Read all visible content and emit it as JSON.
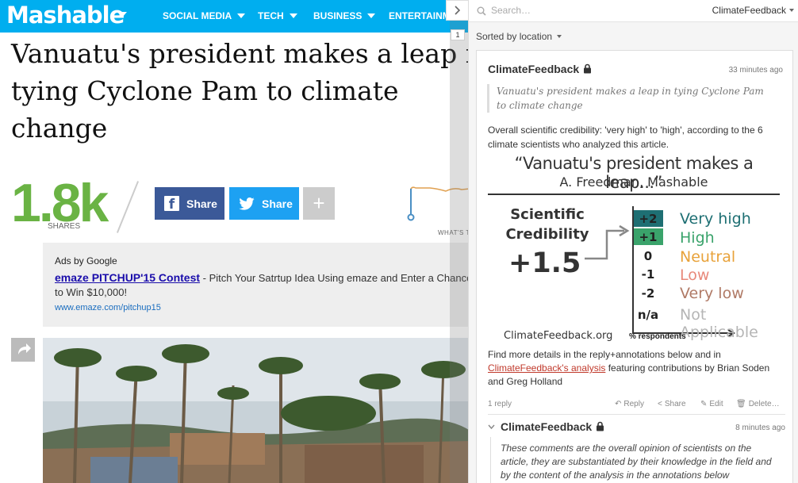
{
  "site": {
    "logo": "Mashable",
    "nav": [
      "SOCIAL MEDIA",
      "TECH",
      "BUSINESS",
      "ENTERTAINM"
    ]
  },
  "article": {
    "headline": "Vanuatu's president makes a leap in tying Cyclone Pam to climate change",
    "shares_count": "1.8k",
    "shares_label": "SHARES",
    "facebook_share": "Share",
    "twitter_share": "Share",
    "more_share": "+",
    "whats_next": "WHAT'S T"
  },
  "ads": {
    "label": "Ads by Google",
    "link_text": "emaze PITCHUP'15 Contest",
    "body": " - Pitch Your Satrtup Idea Using emaze and Enter a Chance to Win $10,000!",
    "url": "www.emaze.com/pitchup15"
  },
  "sidebar": {
    "search_placeholder": "Search…",
    "user": "ClimateFeedback",
    "annotation_count": "1",
    "sort_label": "Sorted by location",
    "annotation": {
      "user": "ClimateFeedback",
      "time": "33 minutes ago",
      "quote": "Vanuatu's president makes a leap in tying Cyclone Pam to climate change",
      "credibility_text": "Overall scientific credibility: 'very high' to 'high', according to the 6 climate scientists who analyzed this article.",
      "details_prefix": "Find more details in the reply+annotations below and in ",
      "details_link": "ClimateFeedback's analysis",
      "details_suffix": " featuring contributions by Brian Soden and Greg Holland",
      "reply_count": "1 reply",
      "actions": {
        "reply": "Reply",
        "share": "Share",
        "edit": "Edit",
        "delete": "Delete…"
      }
    },
    "reply": {
      "user": "ClimateFeedback",
      "time": "8 minutes ago",
      "text": "These comments are the overall opinion of scientists on the article, they are substantiated by their knowledge in the field and by the content of the analysis in the annotations below"
    }
  },
  "figure": {
    "title": "“Vanuatu's president makes a leap...”",
    "subtitle": "A. Freedman, Mashable",
    "scientific": "Scientific",
    "credibility": "Credibility",
    "score": "+1.5",
    "site": "ClimateFeedback.org",
    "respondents": "% respondents",
    "scale": [
      {
        "num": "+2",
        "label": "Very high",
        "color": "#1e6f73",
        "fill": 0.5
      },
      {
        "num": "+1",
        "label": "High",
        "color": "#3aa36b",
        "fill": 0.5
      },
      {
        "num": "0",
        "label": "Neutral",
        "color": "#e8a23a",
        "fill": 0
      },
      {
        "num": "-1",
        "label": "Low",
        "color": "#e8897b",
        "fill": 0
      },
      {
        "num": "-2",
        "label": "Very low",
        "color": "#b07a66",
        "fill": 0
      },
      {
        "num": "n/a",
        "label": "Not Applicable",
        "color": "#b5b5b5",
        "fill": 0
      }
    ]
  }
}
